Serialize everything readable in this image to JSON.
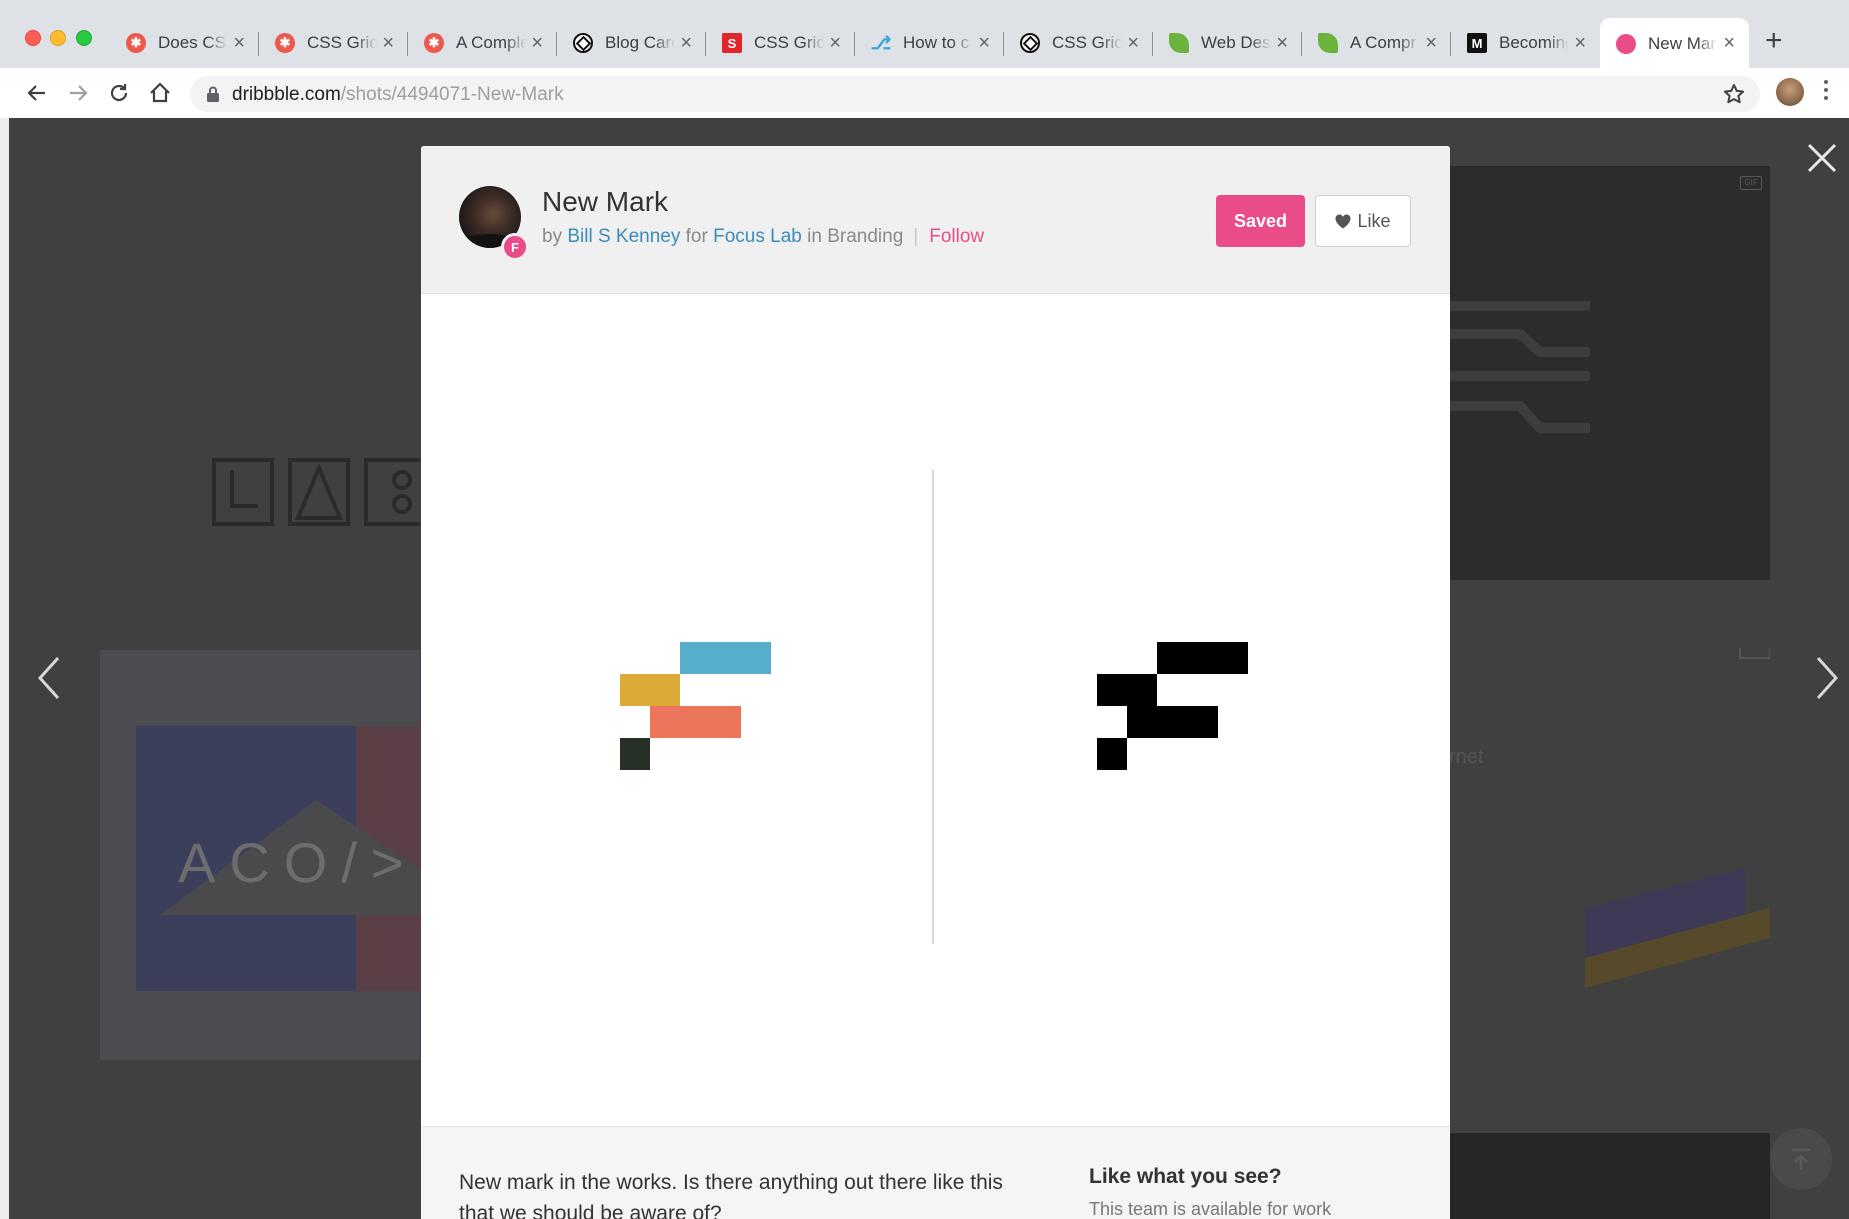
{
  "browser": {
    "tabs": [
      {
        "title": "Does CSS",
        "favicon": "asterisk-icon",
        "color": "#ec5a4b"
      },
      {
        "title": "CSS Grid",
        "favicon": "asterisk-icon",
        "color": "#ec5a4b"
      },
      {
        "title": "A Complete",
        "favicon": "asterisk-icon",
        "color": "#ec5a4b"
      },
      {
        "title": "Blog Card",
        "favicon": "codepen-icon",
        "color": "#111111"
      },
      {
        "title": "CSS Grid",
        "favicon": "s-logo-icon",
        "color": "#e0262a"
      },
      {
        "title": "How to c",
        "favicon": "tree-icon",
        "color": "#3aa7d8"
      },
      {
        "title": "CSS Grid",
        "favicon": "codepen-icon",
        "color": "#111111"
      },
      {
        "title": "Web Des",
        "favicon": "leaf-icon",
        "color": "#6cb33e"
      },
      {
        "title": "A Compr",
        "favicon": "leaf-icon",
        "color": "#6cb33e"
      },
      {
        "title": "Becoming",
        "favicon": "medium-icon",
        "color": "#111111"
      },
      {
        "title": "New Mark",
        "favicon": "dribbble-icon",
        "color": "#ea4c89",
        "active": true
      }
    ],
    "new_tab_label": "+",
    "url_host": "dribbble.com",
    "url_path": "/shots/4494071-New-Mark"
  },
  "shot": {
    "title": "New Mark",
    "by_prefix": "by",
    "author": "Bill S Kenney",
    "for_word": "for",
    "team": "Focus Lab",
    "in_word": "in",
    "category": "Branding",
    "follow_label": "Follow",
    "saved_label": "Saved",
    "like_label": "Like",
    "team_badge_letter": "F",
    "description": "New mark in the works. Is there anything out there like this that we should be aware of?",
    "hire_title": "Like what you see?",
    "hire_text": "This team is available for work"
  },
  "background": {
    "shot_text": "ACO/>E",
    "right_text": "rnet"
  },
  "colors": {
    "accent_pink": "#ea4c89",
    "link_blue": "#3a8bbb",
    "mark_blue": "#55aecb",
    "mark_yellow": "#dcaa36",
    "mark_coral": "#ec765b",
    "mark_dark": "#263027",
    "mark_black": "#000000"
  }
}
